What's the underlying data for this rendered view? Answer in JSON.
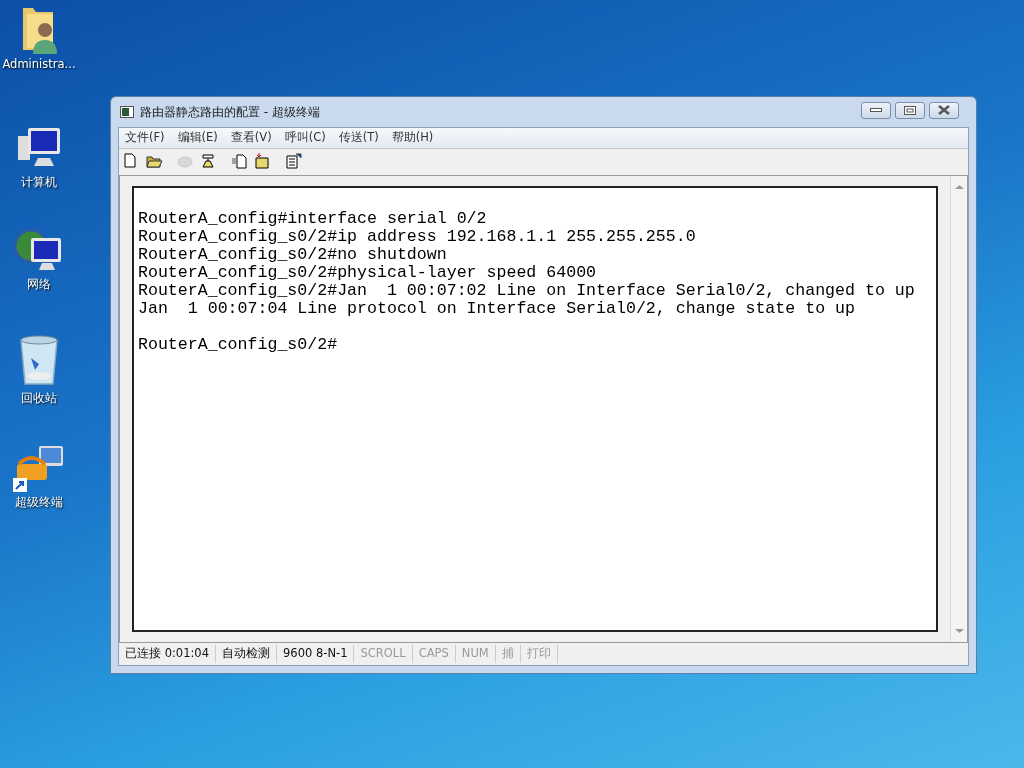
{
  "desktop_icons": [
    {
      "label": "Administra...",
      "kind": "user-folder"
    },
    {
      "label": "计算机",
      "kind": "computer"
    },
    {
      "label": "网络",
      "kind": "network"
    },
    {
      "label": "回收站",
      "kind": "recycle"
    },
    {
      "label": "超级终端",
      "kind": "terminal"
    }
  ],
  "window": {
    "title": "路由器静态路由的配置 - 超级终端"
  },
  "menu": [
    "文件(F)",
    "编辑(E)",
    "查看(V)",
    "呼叫(C)",
    "传送(T)",
    "帮助(H)"
  ],
  "toolbar": [
    {
      "disabled": false
    },
    {
      "disabled": false
    },
    {
      "disabled": true
    },
    {
      "disabled": false
    },
    {
      "disabled": false
    },
    {
      "disabled": false
    },
    {
      "disabled": false
    }
  ],
  "terminal_lines": [
    "RouterA_config#interface serial 0/2",
    "RouterA_config_s0/2#ip address 192.168.1.1 255.255.255.0",
    "RouterA_config_s0/2#no shutdown",
    "RouterA_config_s0/2#physical-layer speed 64000",
    "RouterA_config_s0/2#Jan  1 00:07:02 Line on Interface Serial0/2, changed to up",
    "Jan  1 00:07:04 Line protocol on Interface Serial0/2, change state to up"
  ],
  "prompt_line": "RouterA_config_s0/2#",
  "status_bar": [
    {
      "text": "已连接 0:01:04",
      "disabled": false
    },
    {
      "text": "自动检测",
      "disabled": false
    },
    {
      "text": "9600 8-N-1",
      "disabled": false
    },
    {
      "text": "SCROLL",
      "disabled": true
    },
    {
      "text": "CAPS",
      "disabled": true
    },
    {
      "text": "NUM",
      "disabled": true
    },
    {
      "text": "捕",
      "disabled": true
    },
    {
      "text": "打印",
      "disabled": true
    }
  ]
}
